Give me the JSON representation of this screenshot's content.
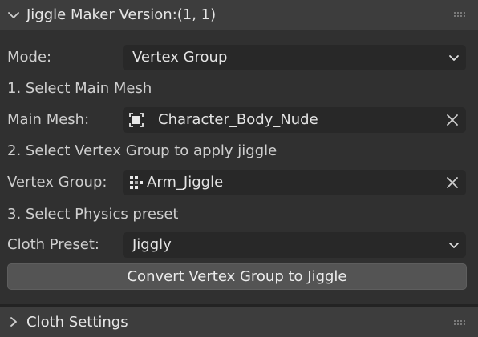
{
  "panel": {
    "title": "Jiggle Maker Version:(1, 1)",
    "expanded": true
  },
  "mode": {
    "label": "Mode:",
    "value": "Vertex Group"
  },
  "step1": "1. Select Main Mesh",
  "main_mesh": {
    "label": "Main Mesh:",
    "value": "Character_Body_Nude",
    "icon": "mesh-object-icon"
  },
  "step2": "2. Select Vertex Group to apply jiggle",
  "vertex_group": {
    "label": "Vertex Group:",
    "value": "Arm_Jiggle",
    "icon": "vertex-group-icon"
  },
  "step3": "3. Select Physics preset",
  "cloth_preset": {
    "label": "Cloth Preset:",
    "value": "Jiggly"
  },
  "convert_button": "Convert Vertex Group to Jiggle",
  "subpanel": {
    "title": "Cloth Settings",
    "expanded": false
  },
  "colors": {
    "background": "#303030",
    "header": "#3d3d3d",
    "field": "#282828",
    "button": "#545454",
    "text": "#d8d8d8"
  }
}
